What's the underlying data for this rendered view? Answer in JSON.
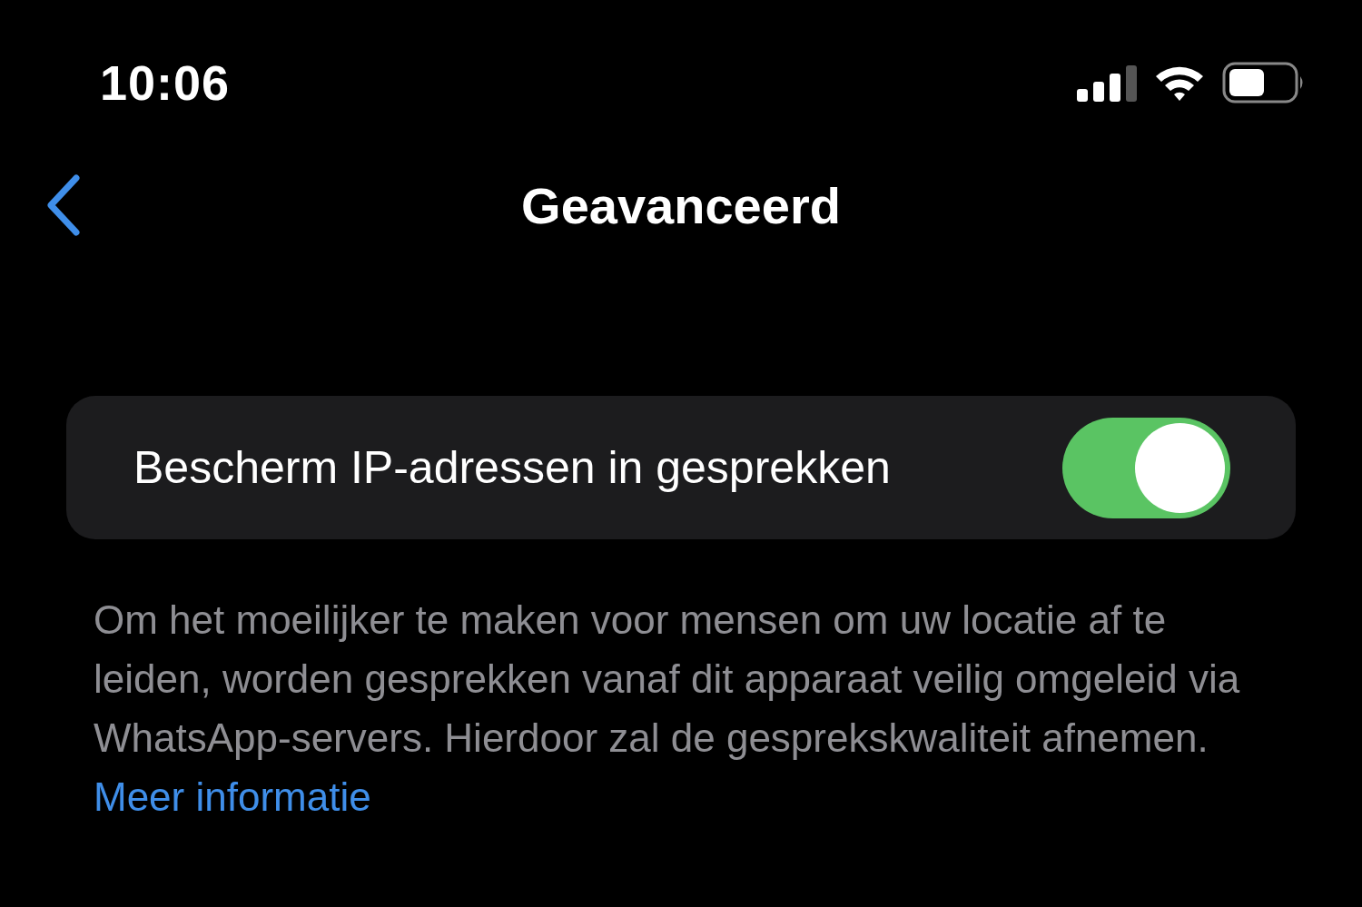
{
  "status_bar": {
    "time": "10:06"
  },
  "nav": {
    "title": "Geavanceerd"
  },
  "settings": [
    {
      "label": "Bescherm IP-adressen in gesprekken",
      "on": true
    }
  ],
  "footer": {
    "text": "Om het moeilijker te maken voor mensen om uw locatie af te leiden, worden gesprekken vanaf dit apparaat veilig omgeleid via WhatsApp-servers. Hierdoor zal de gesprekskwaliteit afnemen.",
    "link": "Meer informatie"
  }
}
